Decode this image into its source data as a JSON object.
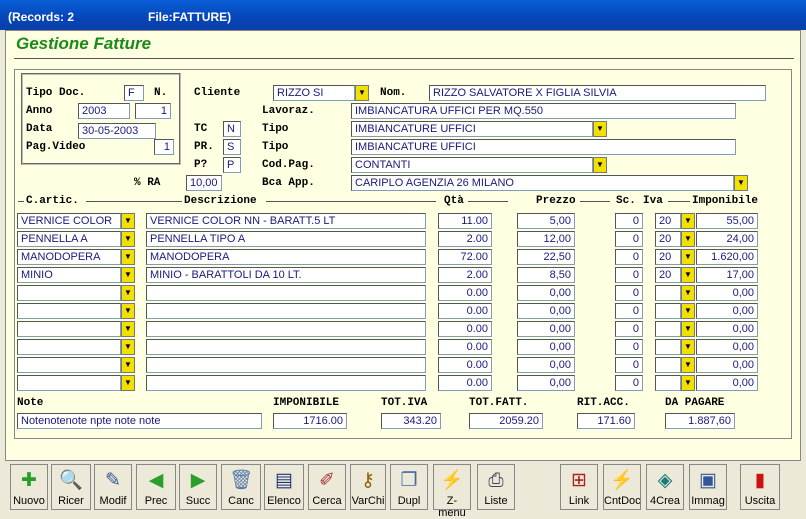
{
  "window": {
    "records": "(Records: 2",
    "file": "File:FATTURE)"
  },
  "app_title": "Gestione Fatture",
  "header": {
    "tipo_doc_label": "Tipo Doc.",
    "tipo_doc_value": "F",
    "n_label": "N.",
    "anno_label": "Anno",
    "anno_value": "2003",
    "anno_num": "1",
    "data_label": "Data",
    "data_value": "30-05-2003",
    "pagvideo_label": "Pag.Video",
    "pagvideo_value": "1",
    "cliente_label": "Cliente",
    "cliente_value": "RIZZO SI",
    "nom_label": "Nom.",
    "nom_value": "RIZZO SALVATORE X FIGLIA SILVIA",
    "lavoraz_label": "Lavoraz.",
    "lavoraz_value": "IMBIANCATURA UFFICI PER MQ.550",
    "tc_label": "TC",
    "tc_value": "N",
    "tipo1_label": "Tipo",
    "tipo1_value": "IMBIANCATURE UFFICI",
    "pr_label": "PR.",
    "pr_value": "S",
    "tipo2_label": "Tipo",
    "tipo2_value": "IMBIANCATURE UFFICI",
    "p_label": "P?",
    "p_value": "P",
    "codpag_label": "Cod.Pag.",
    "codpag_value": "CONTANTI",
    "ra_label": "% RA",
    "ra_value": "10,00",
    "bca_label": "Bca App.",
    "bca_value": "CARIPLO    AGENZIA 26   MILANO"
  },
  "columns": {
    "articolo": "C.artic.",
    "descrizione": "Descrizione",
    "qta": "Qtà",
    "prezzo": "Prezzo",
    "sconto": "Sc.",
    "iva": "Iva",
    "imponibile": "Imponibile"
  },
  "rows": [
    {
      "art": "VERNICE COLOR",
      "desc": "VERNICE COLOR NN - BARATT.5 LT",
      "qta": "11.00",
      "prezzo": "5,00",
      "sc": "0",
      "iva": "20",
      "imp": "55,00"
    },
    {
      "art": "PENNELLA A",
      "desc": "PENNELLA TIPO A",
      "qta": "2.00",
      "prezzo": "12,00",
      "sc": "0",
      "iva": "20",
      "imp": "24,00"
    },
    {
      "art": "MANODOPERA",
      "desc": "MANODOPERA",
      "qta": "72.00",
      "prezzo": "22,50",
      "sc": "0",
      "iva": "20",
      "imp": "1.620,00"
    },
    {
      "art": "MINIO",
      "desc": "MINIO - BARATTOLI DA 10 LT.",
      "qta": "2.00",
      "prezzo": "8,50",
      "sc": "0",
      "iva": "20",
      "imp": "17,00"
    },
    {
      "art": "",
      "desc": "",
      "qta": "0.00",
      "prezzo": "0,00",
      "sc": "0",
      "iva": "",
      "imp": "0,00"
    },
    {
      "art": "",
      "desc": "",
      "qta": "0.00",
      "prezzo": "0,00",
      "sc": "0",
      "iva": "",
      "imp": "0,00"
    },
    {
      "art": "",
      "desc": "",
      "qta": "0.00",
      "prezzo": "0,00",
      "sc": "0",
      "iva": "",
      "imp": "0,00"
    },
    {
      "art": "",
      "desc": "",
      "qta": "0.00",
      "prezzo": "0,00",
      "sc": "0",
      "iva": "",
      "imp": "0,00"
    },
    {
      "art": "",
      "desc": "",
      "qta": "0.00",
      "prezzo": "0,00",
      "sc": "0",
      "iva": "",
      "imp": "0,00"
    },
    {
      "art": "",
      "desc": "",
      "qta": "0.00",
      "prezzo": "0,00",
      "sc": "0",
      "iva": "",
      "imp": "0,00"
    }
  ],
  "totals": {
    "note_label": "Note",
    "note_value": "Notenotenote            npte note note",
    "imponibile_label": "IMPONIBILE",
    "imponibile_value": "1716.00",
    "totiva_label": "TOT.IVA",
    "totiva_value": "343.20",
    "totfatt_label": "TOT.FATT.",
    "totfatt_value": "2059.20",
    "ritacc_label": "RIT.ACC.",
    "ritacc_value": "171.60",
    "dapagare_label": "DA PAGARE",
    "dapagare_value": "1.887,60"
  },
  "toolbar": [
    {
      "name": "nuovo",
      "label": "Nuovo",
      "icon": "new-document-icon",
      "glyph": "✚",
      "color": "#2a9d2a"
    },
    {
      "name": "ricer",
      "label": "Ricer",
      "icon": "magnifier-icon",
      "glyph": "🔍",
      "color": "#345"
    },
    {
      "name": "modif",
      "label": "Modif",
      "icon": "edit-document-icon",
      "glyph": "✎",
      "color": "#335599"
    },
    {
      "name": "prec",
      "label": "Prec",
      "icon": "arrow-left-icon",
      "glyph": "◀",
      "color": "#2aa02a"
    },
    {
      "name": "succ",
      "label": "Succ",
      "icon": "arrow-right-icon",
      "glyph": "▶",
      "color": "#2aa02a"
    },
    {
      "name": "canc",
      "label": "Canc",
      "icon": "trash-icon",
      "glyph": "🗑",
      "color": "#5577aa"
    },
    {
      "name": "elenco",
      "label": "Elenco",
      "icon": "list-table-icon",
      "glyph": "▤",
      "color": "#223377"
    },
    {
      "name": "cerca",
      "label": "Cerca",
      "icon": "search-pen-icon",
      "glyph": "✐",
      "color": "#aa3333"
    },
    {
      "name": "varchi",
      "label": "VarChi",
      "icon": "keys-icon",
      "glyph": "⚷",
      "color": "#886600"
    },
    {
      "name": "dupl",
      "label": "Dupl",
      "icon": "duplicate-icon",
      "glyph": "❐",
      "color": "#4466aa"
    },
    {
      "name": "zmenu",
      "label": "Z-menu",
      "icon": "z-menu-icon",
      "glyph": "⚡",
      "color": "#222"
    },
    {
      "name": "liste",
      "label": "Liste",
      "icon": "printer-icon",
      "glyph": "⎙",
      "color": "#445"
    },
    {
      "name": "link",
      "label": "Link",
      "icon": "network-icon",
      "glyph": "⊞",
      "color": "#aa2222"
    },
    {
      "name": "cntdoc",
      "label": "CntDoc",
      "icon": "counter-icon",
      "glyph": "⚡",
      "color": "#222"
    },
    {
      "name": "4crea",
      "label": "4Crea",
      "icon": "create-icon",
      "glyph": "◈",
      "color": "#1a7a7a"
    },
    {
      "name": "immag",
      "label": "Immag",
      "icon": "image-card-icon",
      "glyph": "▣",
      "color": "#335599"
    },
    {
      "name": "uscita",
      "label": "Uscita",
      "icon": "exit-door-icon",
      "glyph": "▮",
      "color": "#cc1111"
    }
  ]
}
